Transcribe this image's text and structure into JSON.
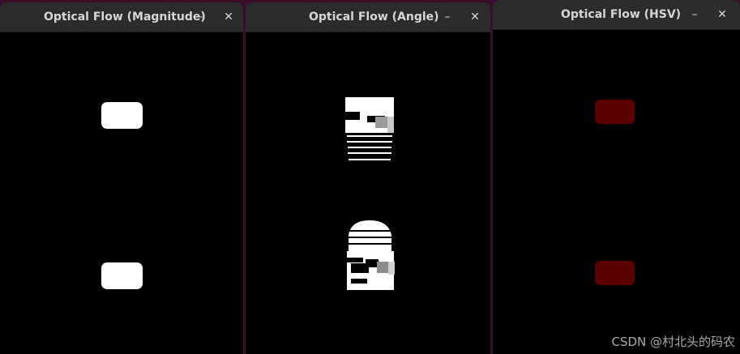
{
  "windows": [
    {
      "title": "Optical Flow (Magnitude)",
      "minimize_icon": "minimize-icon",
      "close_icon": "close-icon",
      "minimize_glyph": "–",
      "close_glyph": "✕"
    },
    {
      "title": "Optical Flow (Angle)",
      "minimize_icon": "minimize-icon",
      "close_icon": "close-icon",
      "minimize_glyph": "–",
      "close_glyph": "✕"
    },
    {
      "title": "Optical Flow (HSV)",
      "minimize_icon": "minimize-icon",
      "close_icon": "close-icon",
      "minimize_glyph": "–",
      "close_glyph": "✕"
    }
  ],
  "watermark": "CSDN @村北头的码农",
  "colors": {
    "desktop": "#3a0f2c",
    "titlebar": "#2c2c2c",
    "title_text": "#d6d6d6",
    "magnitude_blob": "#ffffff",
    "hsv_blob": "#5a0000"
  }
}
